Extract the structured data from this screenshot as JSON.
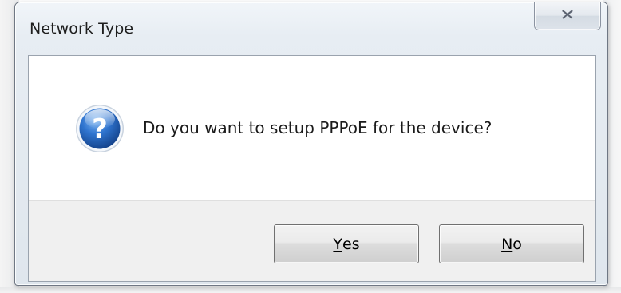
{
  "dialog": {
    "title": "Network Type",
    "close_glyph": "✕",
    "message": "Do you want to setup PPPoE for the device?",
    "icon": "question-icon",
    "buttons": {
      "yes": {
        "mnemonic": "Y",
        "rest": "es"
      },
      "no": {
        "mnemonic": "N",
        "rest": "o"
      }
    }
  },
  "colors": {
    "frame": "#dfe6ed",
    "icon_blue": "#1f5fb5",
    "button_bar": "#f0f0f0"
  }
}
